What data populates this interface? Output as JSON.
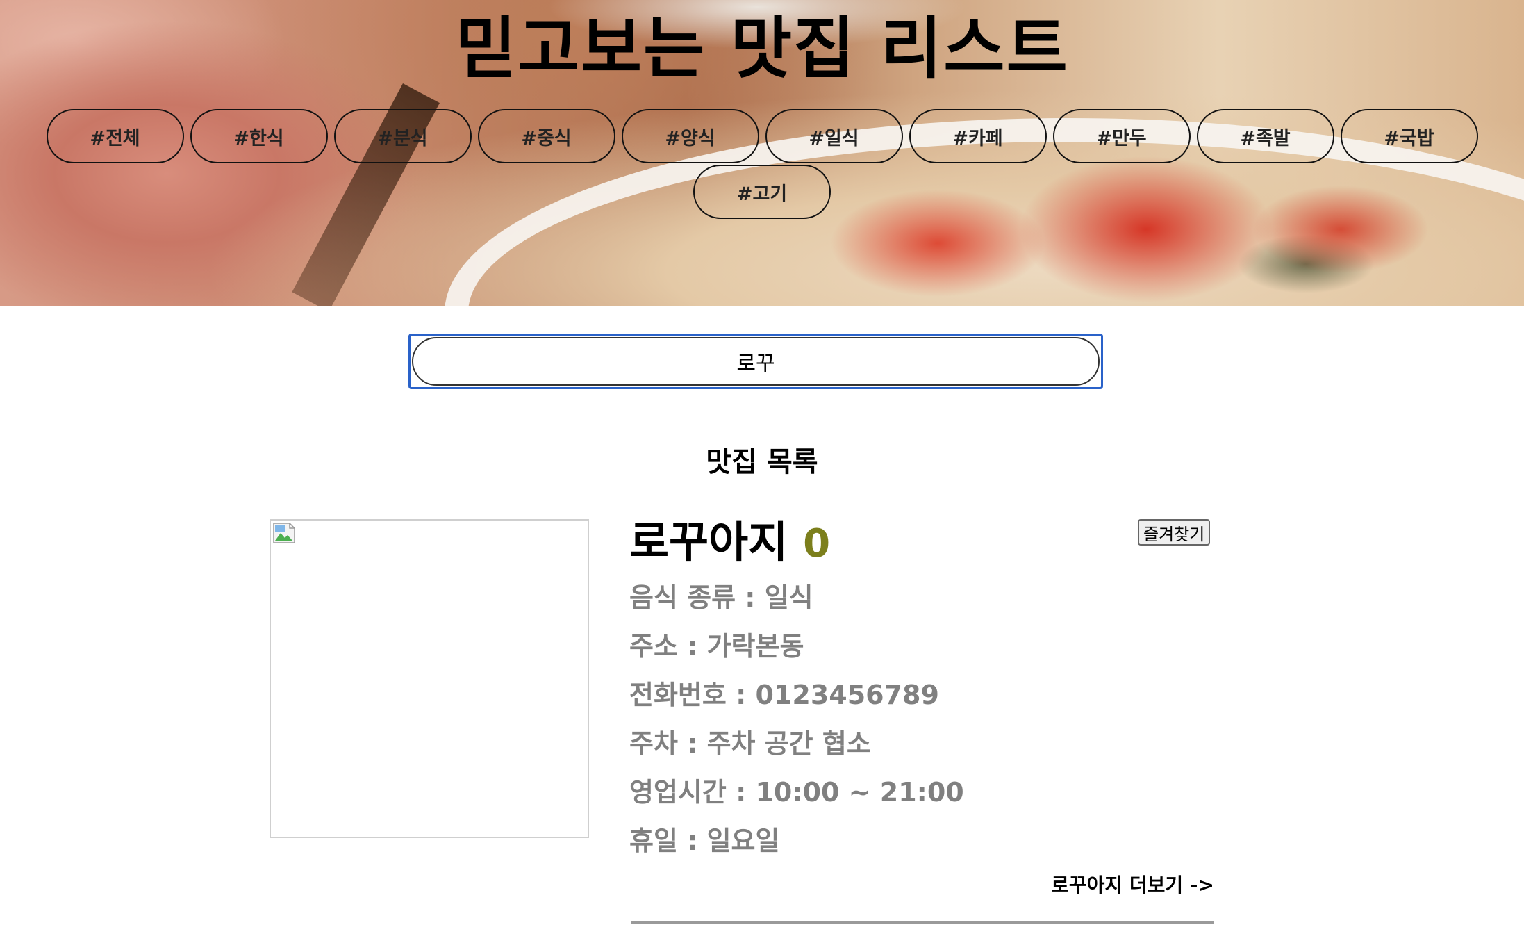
{
  "header": {
    "title": "믿고보는 맛집 리스트",
    "tags_row1": [
      "#전체",
      "#한식",
      "#분식",
      "#중식",
      "#양식",
      "#일식",
      "#카페",
      "#만두",
      "#족발",
      "#국밥"
    ],
    "tags_row2": [
      "#고기"
    ]
  },
  "search": {
    "value": "로꾸"
  },
  "list": {
    "title": "맛집 목록"
  },
  "restaurant": {
    "name": "로꾸아지",
    "score": "0",
    "favorite_label": "즐겨찾기",
    "food_type": "음식 종류 : 일식",
    "address": "주소 : 가락본동",
    "phone": "전화번호 : 0123456789",
    "parking": "주차 : 주차 공간 협소",
    "hours": "영업시간 : 10:00 ~ 21:00",
    "closed": "휴일 : 일요일",
    "more_link": "로꾸아지 더보기 ->"
  },
  "colors": {
    "score": "#7c7f1c",
    "info_text": "#808080",
    "focus_ring": "#2a62c9"
  }
}
